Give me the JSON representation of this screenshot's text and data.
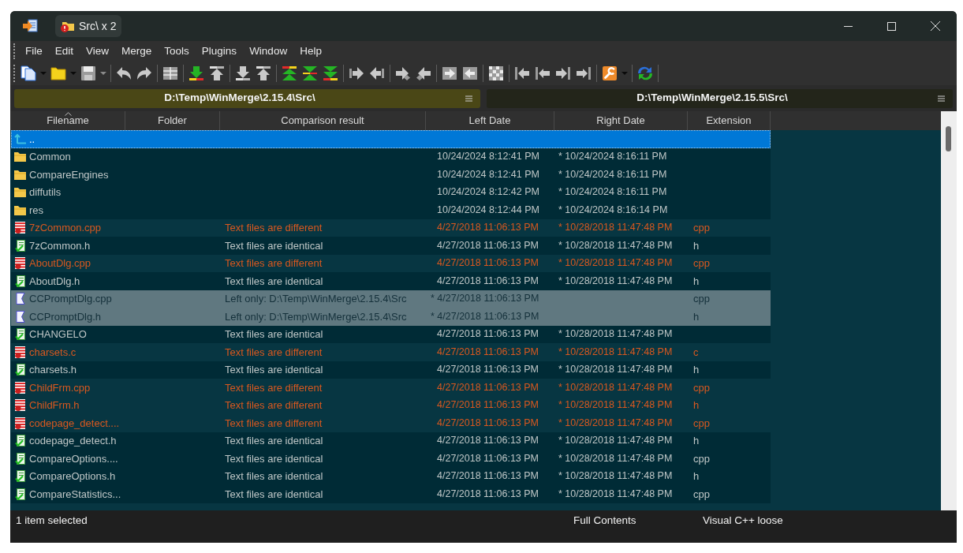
{
  "window": {
    "tabs": [
      {
        "label": "Src\\ x 2",
        "selected": true
      }
    ]
  },
  "menu": [
    "File",
    "Edit",
    "View",
    "Merge",
    "Tools",
    "Plugins",
    "Window",
    "Help"
  ],
  "toolbar": [
    {
      "kind": "new",
      "disabled": false,
      "dropdown": true
    },
    {
      "kind": "open",
      "disabled": false,
      "dropdown": true
    },
    {
      "kind": "save",
      "disabled": true,
      "dropdown": true
    },
    {
      "kind": "separator"
    },
    {
      "kind": "undo",
      "disabled": true
    },
    {
      "kind": "redo",
      "disabled": true
    },
    {
      "kind": "separator"
    },
    {
      "kind": "options",
      "disabled": true
    },
    {
      "kind": "separator"
    },
    {
      "kind": "next_diff",
      "disabled": false
    },
    {
      "kind": "prev_diff",
      "disabled": true
    },
    {
      "kind": "separator"
    },
    {
      "kind": "next_conflict",
      "disabled": true
    },
    {
      "kind": "prev_conflict",
      "disabled": true
    },
    {
      "kind": "separator"
    },
    {
      "kind": "first_diff",
      "disabled": false
    },
    {
      "kind": "current_diff",
      "disabled": false
    },
    {
      "kind": "last_diff",
      "disabled": false
    },
    {
      "kind": "separator"
    },
    {
      "kind": "copy_right",
      "disabled": true
    },
    {
      "kind": "copy_left",
      "disabled": true
    },
    {
      "kind": "separator"
    },
    {
      "kind": "copy_right_advance",
      "disabled": true
    },
    {
      "kind": "copy_left_advance",
      "disabled": true
    },
    {
      "kind": "separator"
    },
    {
      "kind": "copy_all_right",
      "disabled": true
    },
    {
      "kind": "copy_all_left",
      "disabled": true
    },
    {
      "kind": "separator"
    },
    {
      "kind": "all_diffs",
      "disabled": true
    },
    {
      "kind": "separator"
    },
    {
      "kind": "copy_from_right",
      "disabled": true
    },
    {
      "kind": "copy_from_left",
      "disabled": true
    },
    {
      "kind": "copy_to_right",
      "disabled": true
    },
    {
      "kind": "copy_to_left",
      "disabled": true
    },
    {
      "kind": "separator"
    },
    {
      "kind": "tools",
      "disabled": false,
      "dropdown": true
    },
    {
      "kind": "separator"
    },
    {
      "kind": "refresh",
      "disabled": false
    },
    {
      "kind": "separator"
    }
  ],
  "paths": [
    {
      "text": "D:\\Temp\\WinMerge\\2.15.4\\Src\\",
      "active": true
    },
    {
      "text": "D:\\Temp\\WinMerge\\2.15.5\\Src\\",
      "active": false
    }
  ],
  "table": {
    "columns": [
      {
        "label": "Filename",
        "sorted": true
      },
      {
        "label": "Folder",
        "sorted": false
      },
      {
        "label": "Comparison result",
        "sorted": false
      },
      {
        "label": "Left Date",
        "sorted": false
      },
      {
        "label": "Right Date",
        "sorted": false
      },
      {
        "label": "Extension",
        "sorted": false
      }
    ],
    "rows": [
      {
        "kind": "up",
        "selected": true,
        "filename": ".."
      },
      {
        "kind": "folder",
        "selected": false,
        "filename": "Common",
        "left_date": "10/24/2024 8:12:41 PM",
        "right_date": "* 10/24/2024 8:16:11 PM"
      },
      {
        "kind": "folder",
        "selected": false,
        "filename": "CompareEngines",
        "left_date": "10/24/2024 8:12:41 PM",
        "right_date": "* 10/24/2024 8:16:11 PM"
      },
      {
        "kind": "folder",
        "selected": false,
        "filename": "diffutils",
        "left_date": "10/24/2024 8:12:42 PM",
        "right_date": "* 10/24/2024 8:16:11 PM"
      },
      {
        "kind": "folder",
        "selected": false,
        "filename": "res",
        "left_date": "10/24/2024 8:12:44 PM",
        "right_date": "* 10/24/2024 8:16:14 PM"
      },
      {
        "kind": "different",
        "selected": false,
        "filename": "7zCommon.cpp",
        "result": "Text files are different",
        "left_date": "4/27/2018 11:06:13 PM",
        "right_date": "* 10/28/2018 11:47:48 PM",
        "extension": "cpp"
      },
      {
        "kind": "identical",
        "selected": false,
        "filename": "7zCommon.h",
        "result": "Text files are identical",
        "left_date": "4/27/2018 11:06:13 PM",
        "right_date": "* 10/28/2018 11:47:48 PM",
        "extension": "h"
      },
      {
        "kind": "different",
        "selected": false,
        "filename": "AboutDlg.cpp",
        "result": "Text files are different",
        "left_date": "4/27/2018 11:06:13 PM",
        "right_date": "* 10/28/2018 11:47:48 PM",
        "extension": "cpp"
      },
      {
        "kind": "identical",
        "selected": false,
        "filename": "AboutDlg.h",
        "result": "Text files are identical",
        "left_date": "4/27/2018 11:06:13 PM",
        "right_date": "* 10/28/2018 11:47:48 PM",
        "extension": "h"
      },
      {
        "kind": "left_only",
        "selected": false,
        "filename": "CCPromptDlg.cpp",
        "result": "Left only: D:\\Temp\\WinMerge\\2.15.4\\Src",
        "left_date": "* 4/27/2018 11:06:13 PM",
        "extension": "cpp"
      },
      {
        "kind": "left_only",
        "selected": false,
        "filename": "CCPromptDlg.h",
        "result": "Left only: D:\\Temp\\WinMerge\\2.15.4\\Src",
        "left_date": "* 4/27/2018 11:06:13 PM",
        "extension": "h"
      },
      {
        "kind": "identical",
        "selected": false,
        "filename": "CHANGELO",
        "result": "Text files are identical",
        "left_date": "4/27/2018 11:06:13 PM",
        "right_date": "* 10/28/2018 11:47:48 PM"
      },
      {
        "kind": "different",
        "selected": false,
        "filename": "charsets.c",
        "result": "Text files are different",
        "left_date": "4/27/2018 11:06:13 PM",
        "right_date": "* 10/28/2018 11:47:48 PM",
        "extension": "c"
      },
      {
        "kind": "identical",
        "selected": false,
        "filename": "charsets.h",
        "result": "Text files are identical",
        "left_date": "4/27/2018 11:06:13 PM",
        "right_date": "* 10/28/2018 11:47:48 PM",
        "extension": "h"
      },
      {
        "kind": "different",
        "selected": false,
        "filename": "ChildFrm.cpp",
        "result": "Text files are different",
        "left_date": "4/27/2018 11:06:13 PM",
        "right_date": "* 10/28/2018 11:47:48 PM",
        "extension": "cpp"
      },
      {
        "kind": "different",
        "selected": false,
        "filename": "ChildFrm.h",
        "result": "Text files are different",
        "left_date": "4/27/2018 11:06:13 PM",
        "right_date": "* 10/28/2018 11:47:48 PM",
        "extension": "h"
      },
      {
        "kind": "different",
        "selected": false,
        "filename": "codepage_detect....",
        "result": "Text files are different",
        "left_date": "4/27/2018 11:06:13 PM",
        "right_date": "* 10/28/2018 11:47:48 PM",
        "extension": "cpp"
      },
      {
        "kind": "identical",
        "selected": false,
        "filename": "codepage_detect.h",
        "result": "Text files are identical",
        "left_date": "4/27/2018 11:06:13 PM",
        "right_date": "* 10/28/2018 11:47:48 PM",
        "extension": "h"
      },
      {
        "kind": "identical",
        "selected": false,
        "filename": "CompareOptions....",
        "result": "Text files are identical",
        "left_date": "4/27/2018 11:06:13 PM",
        "right_date": "* 10/28/2018 11:47:48 PM",
        "extension": "cpp"
      },
      {
        "kind": "identical",
        "selected": false,
        "filename": "CompareOptions.h",
        "result": "Text files are identical",
        "left_date": "4/27/2018 11:06:13 PM",
        "right_date": "* 10/28/2018 11:47:48 PM",
        "extension": "h"
      },
      {
        "kind": "identical",
        "selected": false,
        "filename": "CompareStatistics...",
        "result": "Text files are identical",
        "left_date": "4/27/2018 11:06:13 PM",
        "right_date": "* 10/28/2018 11:47:48 PM",
        "extension": "cpp"
      }
    ]
  },
  "status_bar": [
    "1 item selected",
    "Full Contents",
    "Visual C++ loose"
  ]
}
